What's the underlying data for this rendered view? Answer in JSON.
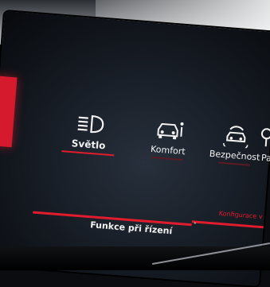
{
  "menu": {
    "items": [
      {
        "label": "Světlo",
        "icon": "headlight-icon",
        "active": true
      },
      {
        "label": "Komfort",
        "icon": "car-comfort-icon",
        "active": false
      },
      {
        "label": "Bezpečnost",
        "icon": "car-safety-icon",
        "active": false
      },
      {
        "label": "Pa",
        "icon": "parking-icon",
        "active": false
      }
    ]
  },
  "bottom_bar": {
    "driving_functions_label": "Funkce při řízení",
    "configuration_label": "Konfigurace v"
  },
  "colors": {
    "accent": "#e21b2d",
    "background": "#151a22",
    "text": "#f2f2f2"
  }
}
